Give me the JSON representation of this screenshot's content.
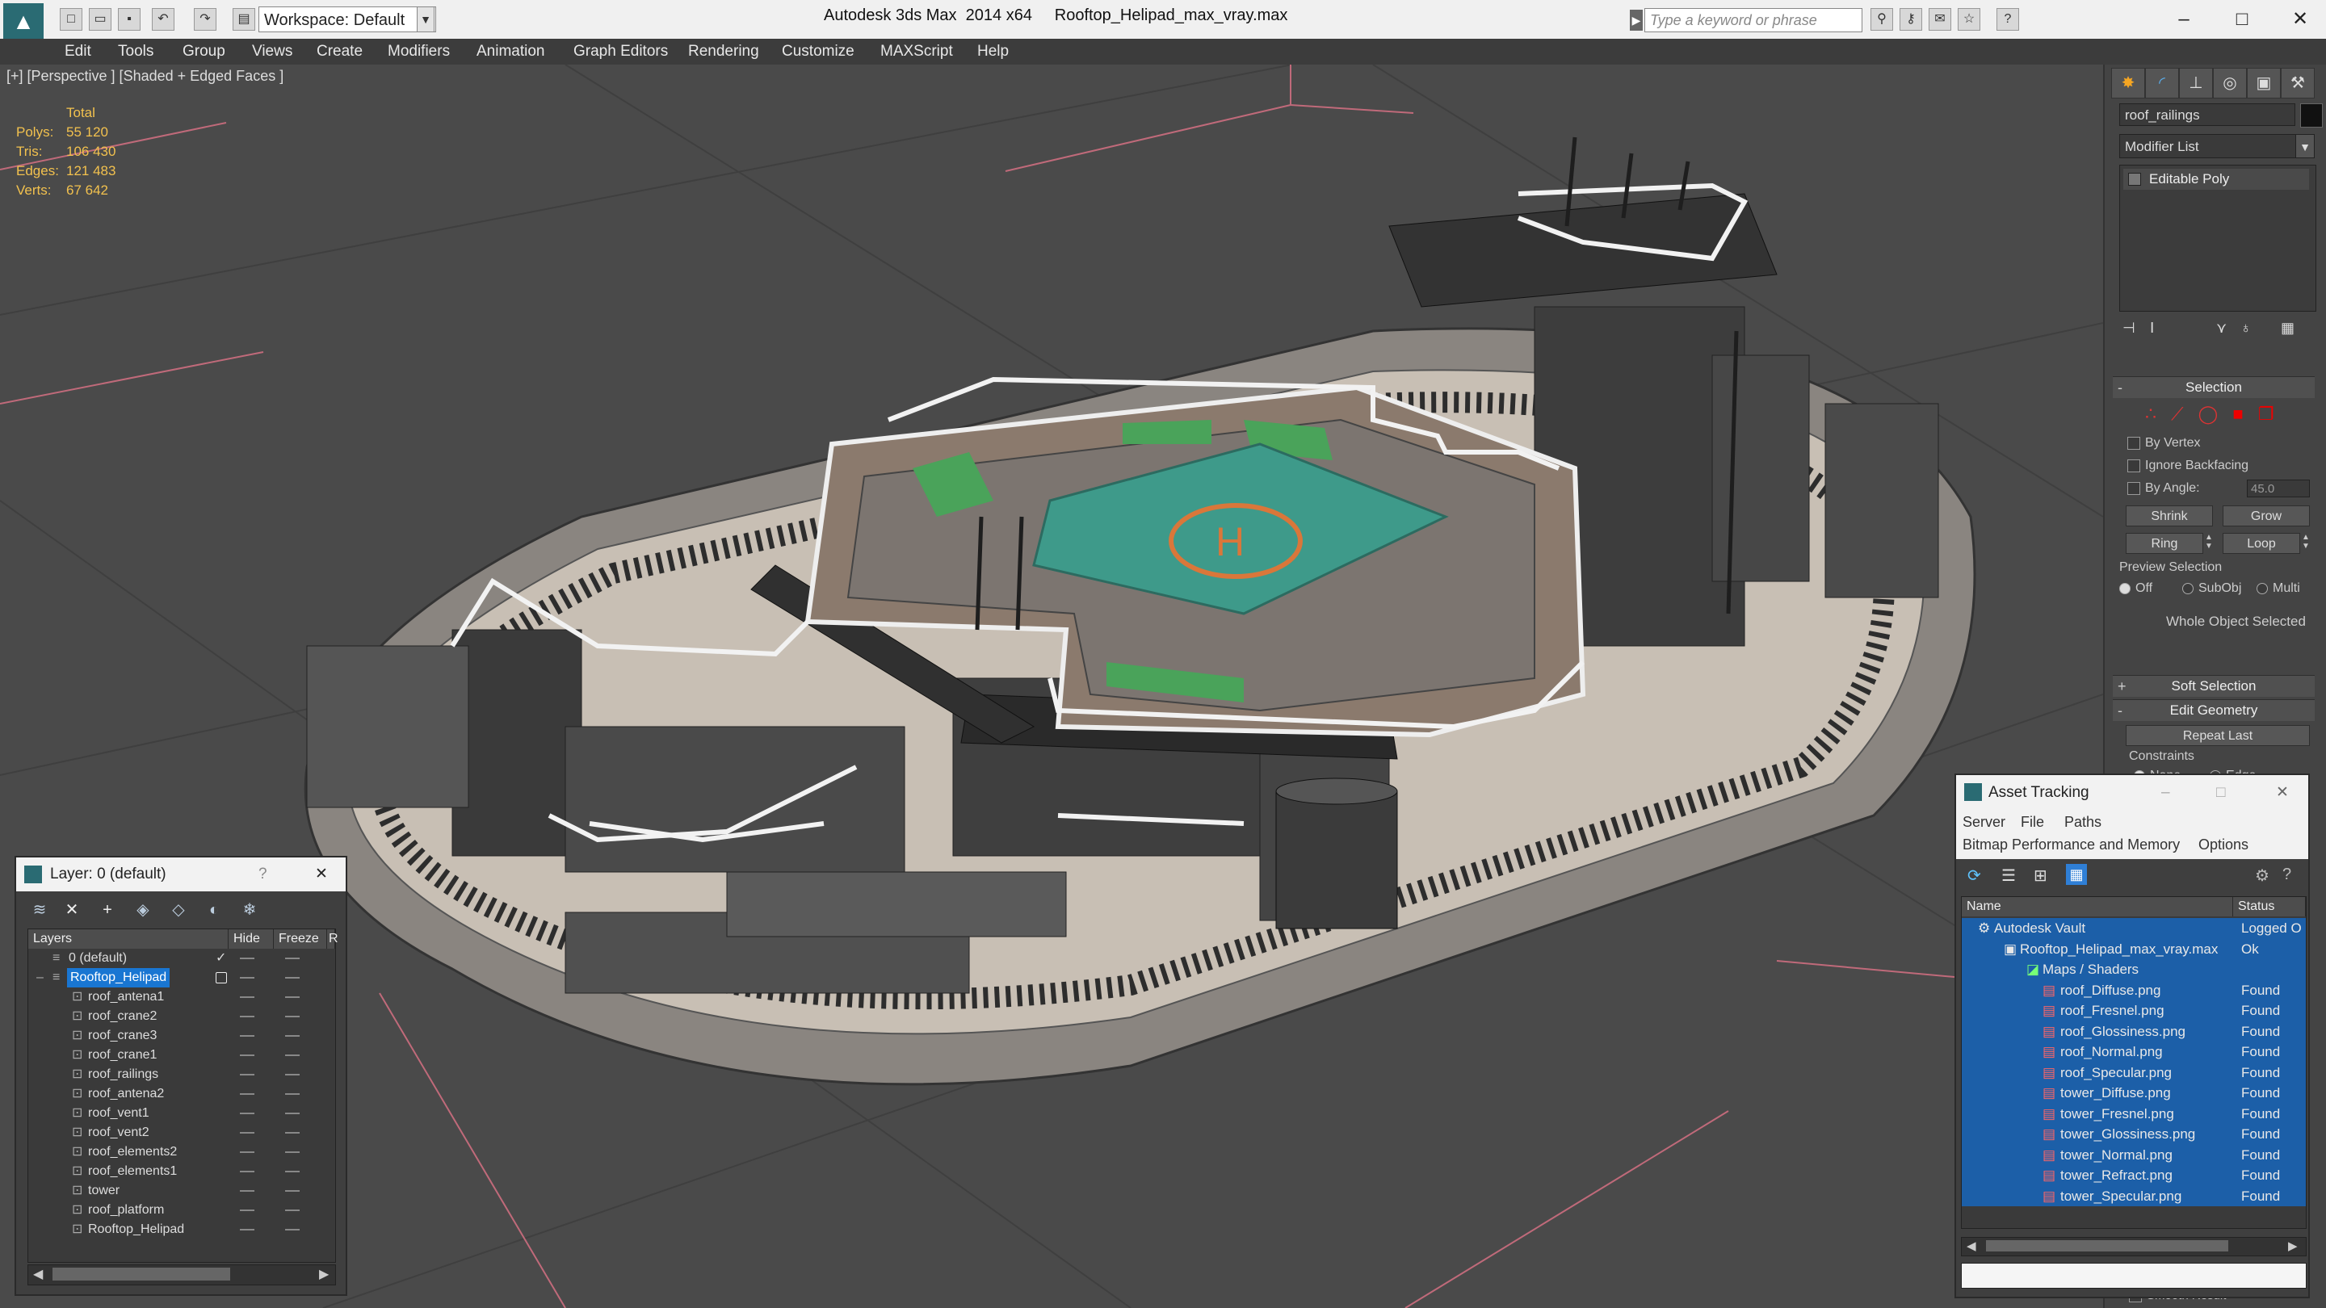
{
  "titlebar": {
    "app_title": "Autodesk 3ds Max  2014 x64",
    "file_title": "Rooftop_Helipad_max_vray.max",
    "workspace": "Workspace: Default",
    "search_placeholder": "Type a keyword or phrase"
  },
  "menu": [
    "Edit",
    "Tools",
    "Group",
    "Views",
    "Create",
    "Modifiers",
    "Animation",
    "Graph Editors",
    "Rendering",
    "Customize",
    "MAXScript",
    "Help"
  ],
  "viewport": {
    "label": "[+] [Perspective ] [Shaded + Edged Faces ]",
    "stats": {
      "header": "Total",
      "polys_label": "Polys:",
      "polys": "55 120",
      "tris_label": "Tris:",
      "tris": "106 430",
      "edges_label": "Edges:",
      "edges": "121 483",
      "verts_label": "Verts:",
      "verts": "67 642"
    }
  },
  "command_panel": {
    "object_name": "roof_railings",
    "modifier_list": "Modifier List",
    "stack_item": "Editable Poly",
    "selection": {
      "title": "Selection",
      "by_vertex": "By Vertex",
      "ignore_backfacing": "Ignore Backfacing",
      "by_angle": "By Angle:",
      "angle_value": "45.0",
      "shrink": "Shrink",
      "grow": "Grow",
      "ring": "Ring",
      "loop": "Loop",
      "preview_selection": "Preview Selection",
      "off": "Off",
      "subobj": "SubObj",
      "multi": "Multi",
      "whole_object": "Whole Object Selected"
    },
    "soft_selection": "Soft Selection",
    "edit_geometry": "Edit Geometry",
    "repeat_last": "Repeat Last",
    "constraints": "Constraints",
    "none": "None",
    "edge": "Edge",
    "smooth_result": "Smooth Result"
  },
  "layer_dialog": {
    "title": "Layer: 0 (default)",
    "col_layers": "Layers",
    "col_hide": "Hide",
    "col_freeze": "Freeze",
    "col_r": "R",
    "rows": [
      {
        "name": "0 (default)",
        "level": 0
      },
      {
        "name": "Rooftop_Helipad",
        "level": 0
      },
      {
        "name": "roof_antena1",
        "level": 1
      },
      {
        "name": "roof_crane2",
        "level": 1
      },
      {
        "name": "roof_crane3",
        "level": 1
      },
      {
        "name": "roof_crane1",
        "level": 1
      },
      {
        "name": "roof_railings",
        "level": 1
      },
      {
        "name": "roof_antena2",
        "level": 1
      },
      {
        "name": "roof_vent1",
        "level": 1
      },
      {
        "name": "roof_vent2",
        "level": 1
      },
      {
        "name": "roof_elements2",
        "level": 1
      },
      {
        "name": "roof_elements1",
        "level": 1
      },
      {
        "name": "tower",
        "level": 1
      },
      {
        "name": "roof_platform",
        "level": 1
      },
      {
        "name": "Rooftop_Helipad",
        "level": 1
      }
    ]
  },
  "asset_dialog": {
    "title": "Asset Tracking",
    "menu_server": "Server",
    "menu_file": "File",
    "menu_paths": "Paths",
    "menu_bitmap": "Bitmap Performance and Memory",
    "menu_options": "Options",
    "col_name": "Name",
    "col_status": "Status",
    "rows": [
      {
        "name": "Autodesk Vault",
        "status": "Logged O",
        "level": 0
      },
      {
        "name": "Rooftop_Helipad_max_vray.max",
        "status": "Ok",
        "level": 1
      },
      {
        "name": "Maps / Shaders",
        "status": "",
        "level": 2
      },
      {
        "name": "roof_Diffuse.png",
        "status": "Found",
        "level": 3
      },
      {
        "name": "roof_Fresnel.png",
        "status": "Found",
        "level": 3
      },
      {
        "name": "roof_Glossiness.png",
        "status": "Found",
        "level": 3
      },
      {
        "name": "roof_Normal.png",
        "status": "Found",
        "level": 3
      },
      {
        "name": "roof_Specular.png",
        "status": "Found",
        "level": 3
      },
      {
        "name": "tower_Diffuse.png",
        "status": "Found",
        "level": 3
      },
      {
        "name": "tower_Fresnel.png",
        "status": "Found",
        "level": 3
      },
      {
        "name": "tower_Glossiness.png",
        "status": "Found",
        "level": 3
      },
      {
        "name": "tower_Normal.png",
        "status": "Found",
        "level": 3
      },
      {
        "name": "tower_Refract.png",
        "status": "Found",
        "level": 3
      },
      {
        "name": "tower_Specular.png",
        "status": "Found",
        "level": 3
      }
    ]
  },
  "colors": {
    "accent": "#1976d2",
    "stats_text": "#f2c14e",
    "helipad": "#3e9a8a",
    "helipad_marking": "#d9773a"
  }
}
